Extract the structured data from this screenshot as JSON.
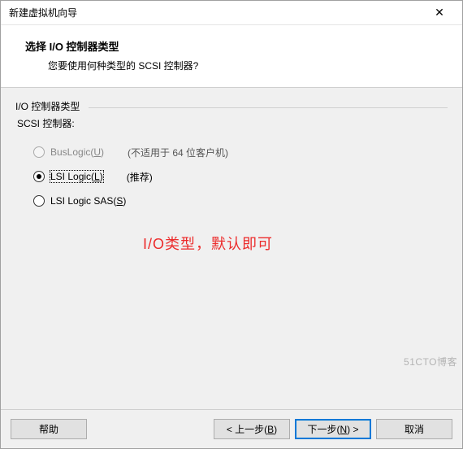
{
  "window": {
    "title": "新建虚拟机向导",
    "close_glyph": "✕"
  },
  "header": {
    "title": "选择 I/O 控制器类型",
    "subtitle": "您要使用何种类型的 SCSI 控制器?"
  },
  "group": {
    "title": "I/O 控制器类型",
    "scsi_label": "SCSI 控制器:"
  },
  "options": [
    {
      "label_pre": "BusLogic(",
      "hotkey": "U",
      "label_post": ")",
      "hint": "(不适用于 64 位客户机)",
      "selected": false,
      "enabled": false
    },
    {
      "label_pre": "LSI Logic(",
      "hotkey": "L",
      "label_post": ")",
      "hint": "(推荐)",
      "selected": true,
      "enabled": true
    },
    {
      "label_pre": "LSI Logic SAS(",
      "hotkey": "S",
      "label_post": ")",
      "hint": "",
      "selected": false,
      "enabled": true
    }
  ],
  "annotation": "I/O类型，默认即可",
  "buttons": {
    "help": "帮助",
    "back_pre": "< 上一步(",
    "back_hotkey": "B",
    "back_post": ")",
    "next_pre": "下一步(",
    "next_hotkey": "N",
    "next_post": ") >",
    "cancel": "取消"
  },
  "watermark": "51CTO博客"
}
